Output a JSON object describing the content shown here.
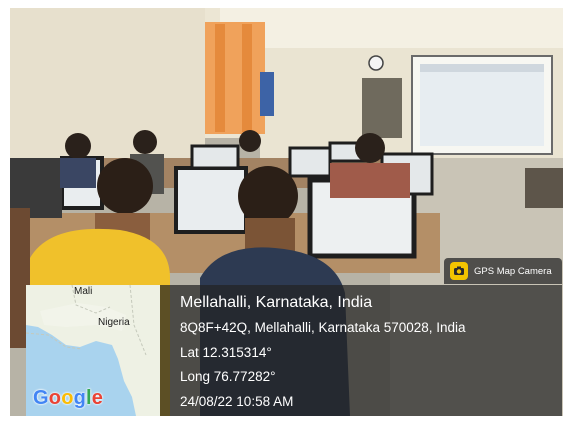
{
  "photo": {
    "subject": "computer-lab-photo"
  },
  "badge": {
    "label": "GPS Map Camera",
    "icon": "gps-map-camera-icon",
    "icon_color": "#f3c400"
  },
  "map": {
    "labels": {
      "mali": "Mali",
      "nigeria": "Nigeria"
    },
    "logo": [
      "G",
      "o",
      "o",
      "g",
      "l",
      "e"
    ],
    "colors": {
      "sea": "#a9d3ee",
      "land": "#eef1e4"
    }
  },
  "location": {
    "title": "Mellahalli, Karnataka, India",
    "address": "8Q8F+42Q, Mellahalli, Karnataka 570028, India",
    "lat": "Lat 12.315314°",
    "long": "Long 76.77282°",
    "datetime": "24/08/22 10:58 AM"
  }
}
